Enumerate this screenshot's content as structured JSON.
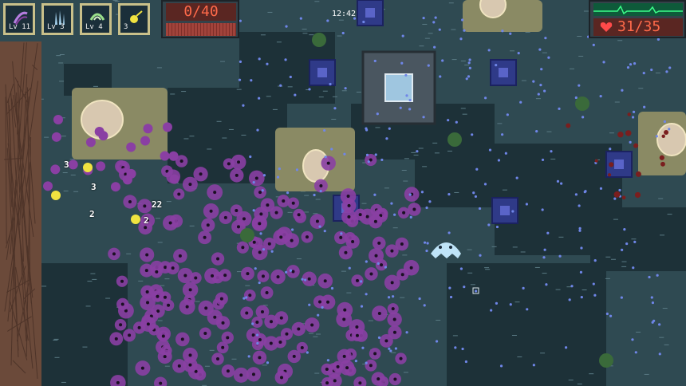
{
  "hud": {
    "weapons": [
      {
        "label": "Lv 11",
        "icon": "purple-wave-icon"
      },
      {
        "label": "Lv 3",
        "icon": "ice-spikes-icon"
      },
      {
        "label": "Lv 4",
        "icon": "green-dish-icon"
      },
      {
        "label": "3",
        "icon": "yellow-bolt-icon"
      }
    ],
    "kill_counter": "0/40",
    "timer": "12:42",
    "health": "31/35"
  },
  "damage_numbers": [
    "3",
    "3",
    "2",
    "22",
    "2"
  ],
  "colors": {
    "water": "#2f4a52",
    "deep": "#1d3138",
    "sand": "#8a8a64",
    "enemy_purple": "#8a3fa3",
    "hud_gold": "#c9c08a",
    "hud_red": "#ff6a4a"
  }
}
